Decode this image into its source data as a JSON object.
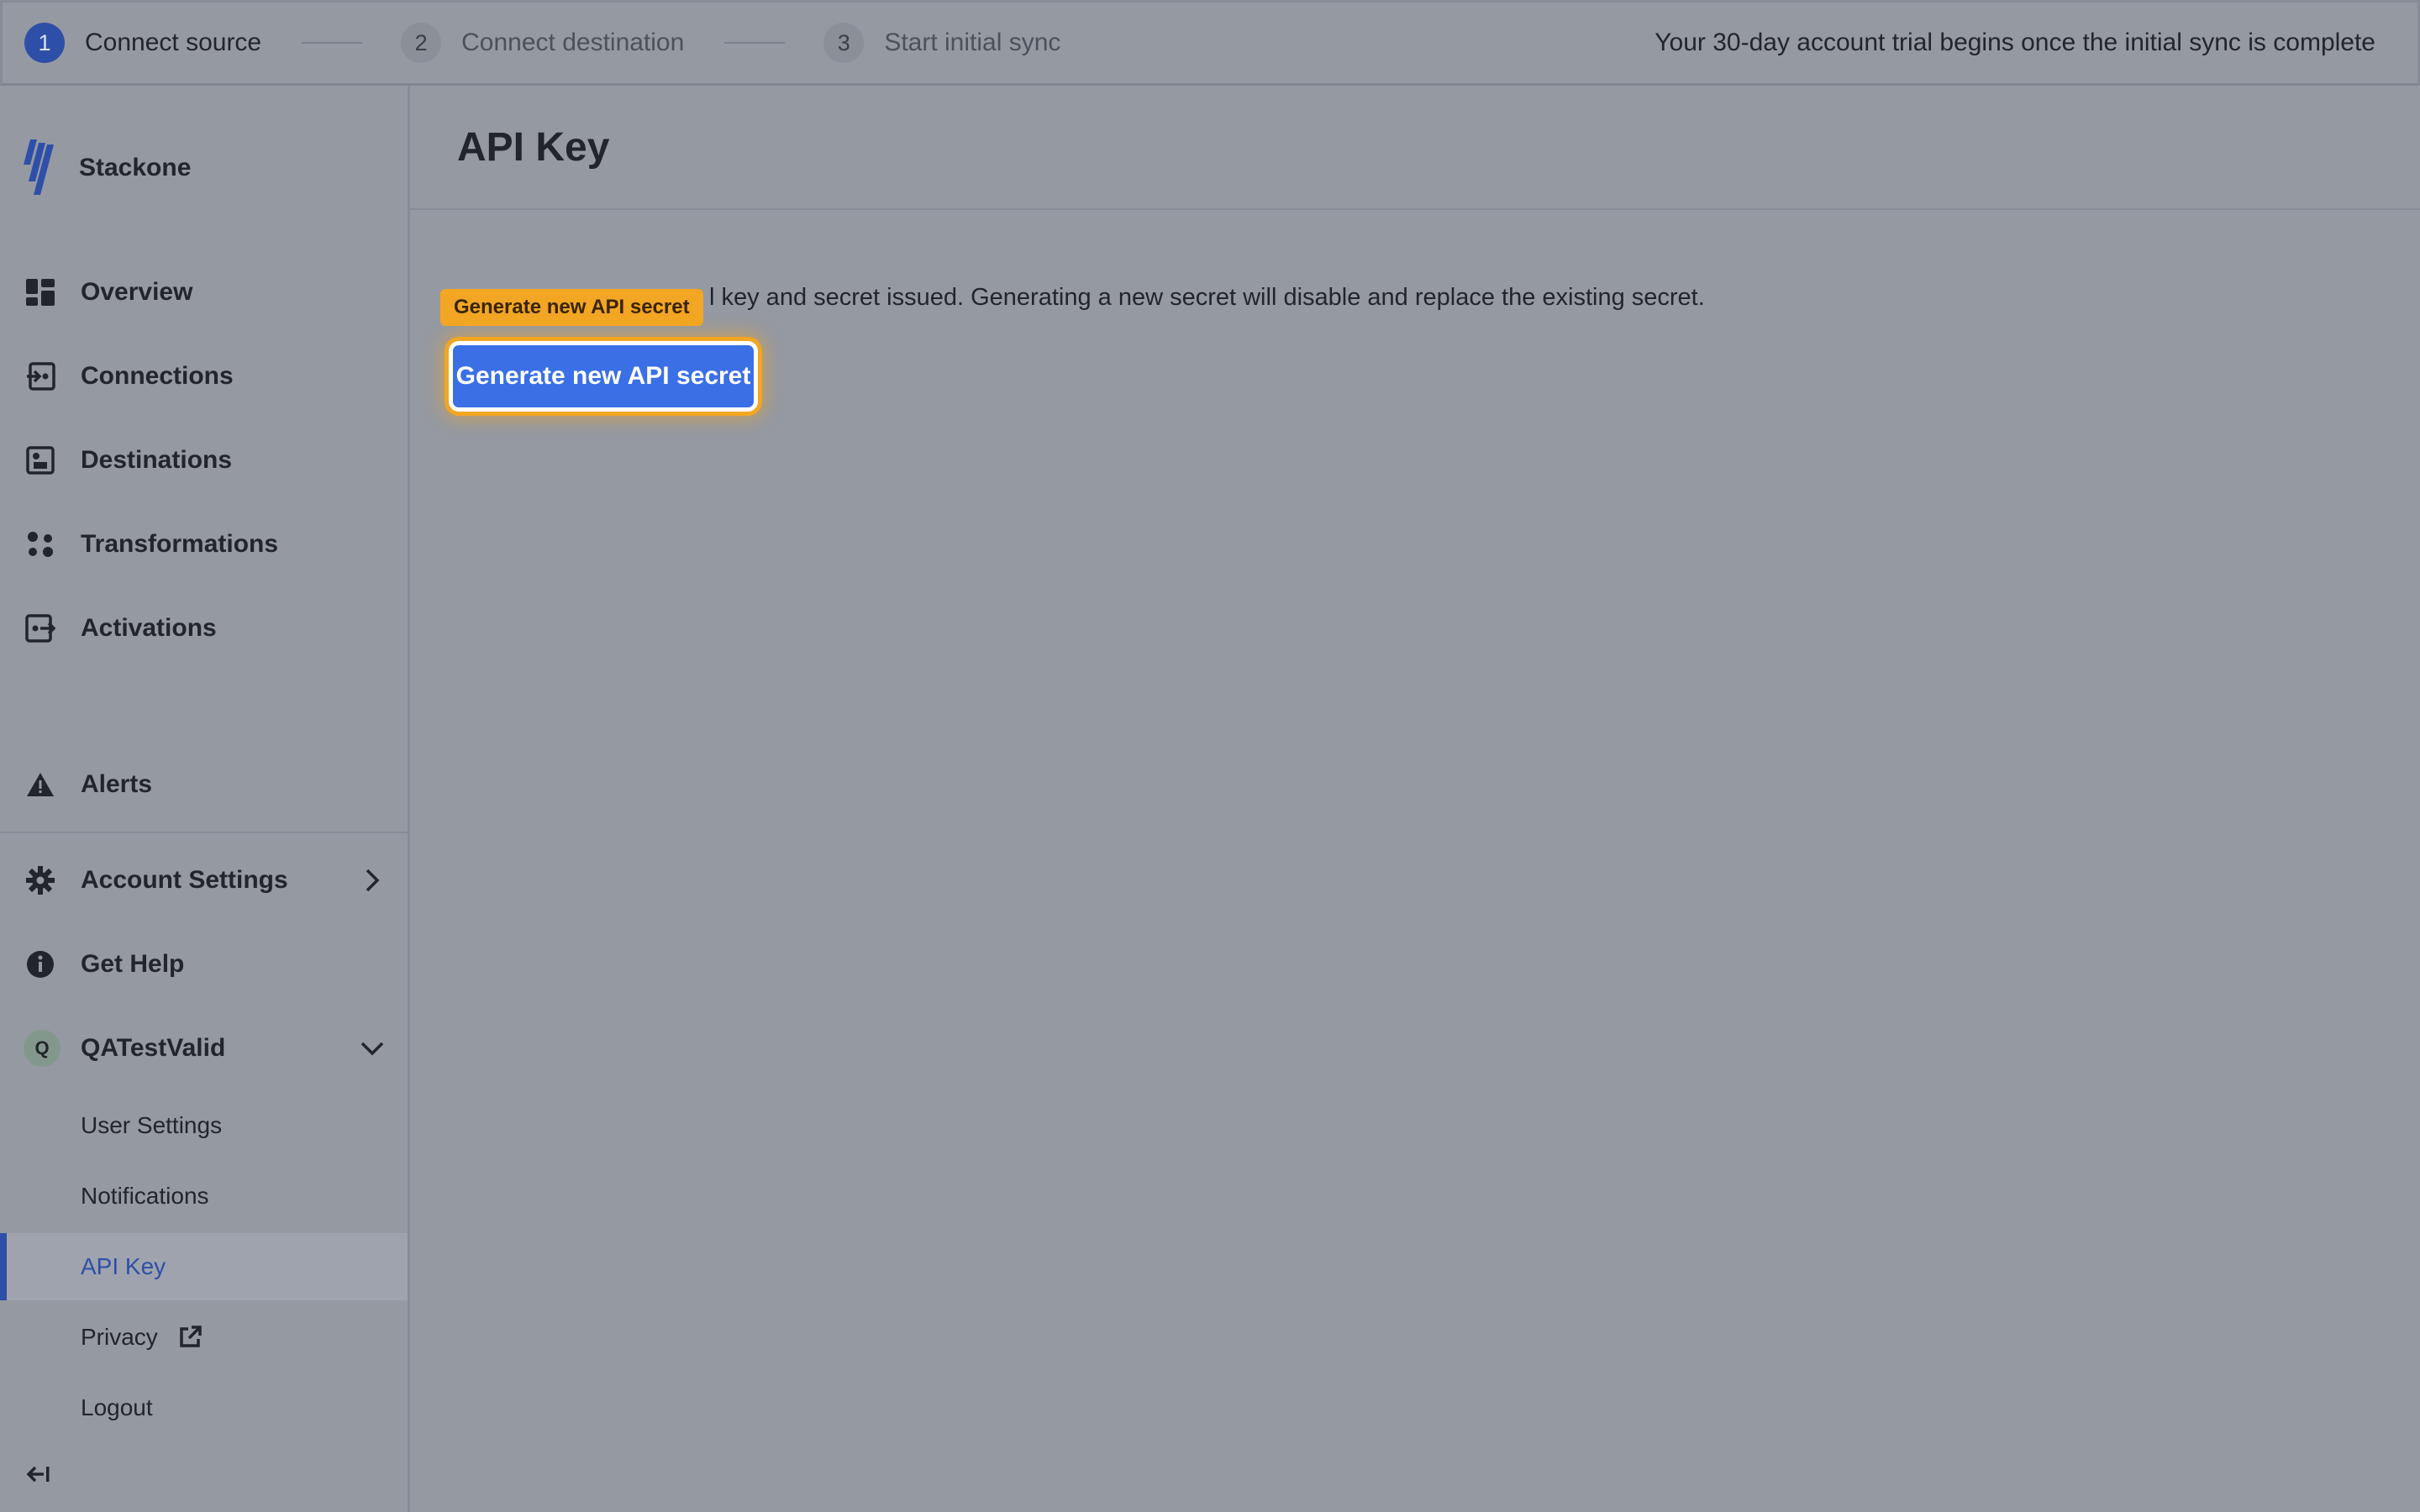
{
  "stepper": {
    "steps": [
      {
        "number": "1",
        "label": "Connect source"
      },
      {
        "number": "2",
        "label": "Connect destination"
      },
      {
        "number": "3",
        "label": "Start initial sync"
      }
    ],
    "trial_notice": "Your 30-day account trial begins once the initial sync is complete"
  },
  "sidebar": {
    "brand": "Stackone",
    "nav": [
      {
        "label": "Overview",
        "icon": "dashboard-icon"
      },
      {
        "label": "Connections",
        "icon": "connection-icon"
      },
      {
        "label": "Destinations",
        "icon": "destination-icon"
      },
      {
        "label": "Transformations",
        "icon": "transformation-icon"
      },
      {
        "label": "Activations",
        "icon": "activation-icon"
      }
    ],
    "alerts": "Alerts",
    "account_settings": "Account Settings",
    "get_help": "Get Help",
    "user": {
      "initial": "Q",
      "name": "QATestValid"
    },
    "user_menu": {
      "user_settings": "User Settings",
      "notifications": "Notifications",
      "api_key": "API Key",
      "privacy": "Privacy",
      "logout": "Logout"
    }
  },
  "main": {
    "title": "API Key",
    "description": "l key and secret issued. Generating a new secret will disable and replace the existing secret.",
    "tooltip": "Generate new API secret",
    "button": "Generate new API secret"
  },
  "colors": {
    "accent": "#3a6fe6",
    "highlight": "#f2a623",
    "brand": "#2e4fa8"
  }
}
